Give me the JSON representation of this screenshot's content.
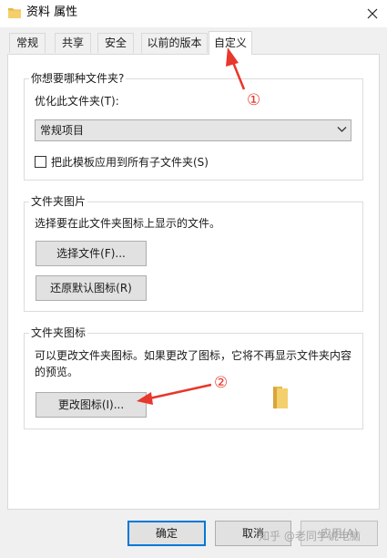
{
  "window": {
    "title": "资料 属性",
    "icon": "folder-icon",
    "close_icon": "close-icon"
  },
  "tabs": [
    {
      "label": "常规",
      "active": false
    },
    {
      "label": "共享",
      "active": false
    },
    {
      "label": "安全",
      "active": false
    },
    {
      "label": "以前的版本",
      "active": false
    },
    {
      "label": "自定义",
      "active": true
    }
  ],
  "optimize_group": {
    "legend": "你想要哪种文件夹?",
    "optimize_label": "优化此文件夹(T):",
    "dropdown_value": "常规项目",
    "checkbox_label": "把此模板应用到所有子文件夹(S)",
    "checkbox_checked": false
  },
  "picture_group": {
    "legend": "文件夹图片",
    "description": "选择要在此文件夹图标上显示的文件。",
    "choose_file_button": "选择文件(F)...",
    "restore_default_button": "还原默认图标(R)"
  },
  "icon_group": {
    "legend": "文件夹图标",
    "description_line1": "可以更改文件夹图标。如果更改了图标，它将不再显示文件夹内容",
    "description_line2": "的预览。",
    "change_icon_button": "更改图标(I)..."
  },
  "footer": {
    "ok_button": "确定",
    "cancel_button": "取消",
    "apply_button": "应用(A)"
  },
  "annotations": {
    "marker_1": "①",
    "marker_2": "②",
    "color": "#e8372b"
  },
  "watermark": "知乎 @老同学说电脑"
}
